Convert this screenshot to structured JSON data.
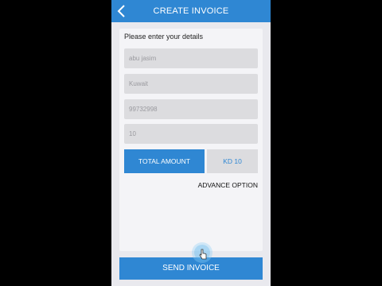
{
  "appbar": {
    "title": "CREATE INVOICE",
    "back_icon": "chevron-left-icon"
  },
  "form": {
    "heading": "Please enter your details",
    "fields": [
      {
        "name": "name-field",
        "value": "abu jasim"
      },
      {
        "name": "country-field",
        "value": "Kuwait"
      },
      {
        "name": "phone-field",
        "value": "99732998"
      },
      {
        "name": "amount-field",
        "value": "10"
      }
    ],
    "total_label": "TOTAL AMOUNT",
    "total_value": "KD 10",
    "advance_label": "ADVANCE OPTION"
  },
  "actions": {
    "send_label": "SEND INVOICE"
  },
  "colors": {
    "accent": "#2f87d3",
    "background": "#e9e9ee"
  }
}
